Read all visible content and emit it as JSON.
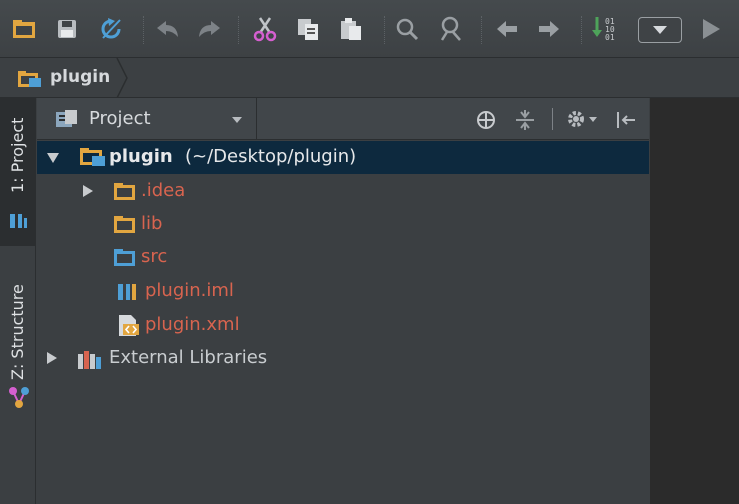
{
  "toolbar": {
    "icons": [
      "folder-open-icon",
      "save-icon",
      "sync-icon",
      "undo-icon",
      "redo-icon",
      "cut-icon",
      "copy-icon",
      "paste-icon",
      "find-icon",
      "find-usages-icon",
      "back-icon",
      "forward-icon",
      "vcs-update-icon",
      "run-config-dropdown-icon",
      "run-icon"
    ],
    "vcs_glyph": "01\n10\n01"
  },
  "breadcrumb": {
    "label": "plugin"
  },
  "left_strip": {
    "tabs": [
      {
        "label": "1: Project",
        "active": true
      },
      {
        "label": "Z: Structure",
        "active": false
      }
    ]
  },
  "panel": {
    "title": "Project",
    "tree": [
      {
        "label": "plugin",
        "suffix": " (~/Desktop/plugin)",
        "selected": true,
        "expanded": true,
        "icon": "module-folder-icon"
      },
      {
        "label": ".idea",
        "color": "#d8644f",
        "expandable": true,
        "icon": "folder-icon"
      },
      {
        "label": "lib",
        "color": "#d8644f",
        "icon": "folder-icon"
      },
      {
        "label": "src",
        "color": "#d8644f",
        "icon": "source-folder-icon"
      },
      {
        "label": "plugin.iml",
        "color": "#d8644f",
        "icon": "iml-file-icon"
      },
      {
        "label": "plugin.xml",
        "color": "#d8644f",
        "icon": "xml-file-icon"
      },
      {
        "label": "External Libraries",
        "color": "#c9cdd0",
        "expandable": true,
        "icon": "libraries-icon"
      }
    ]
  },
  "colors": {
    "selection": "#0d293e",
    "folder": "#e2a640",
    "src": "#4e9fd6",
    "tab_bg": "#2b2e30"
  }
}
